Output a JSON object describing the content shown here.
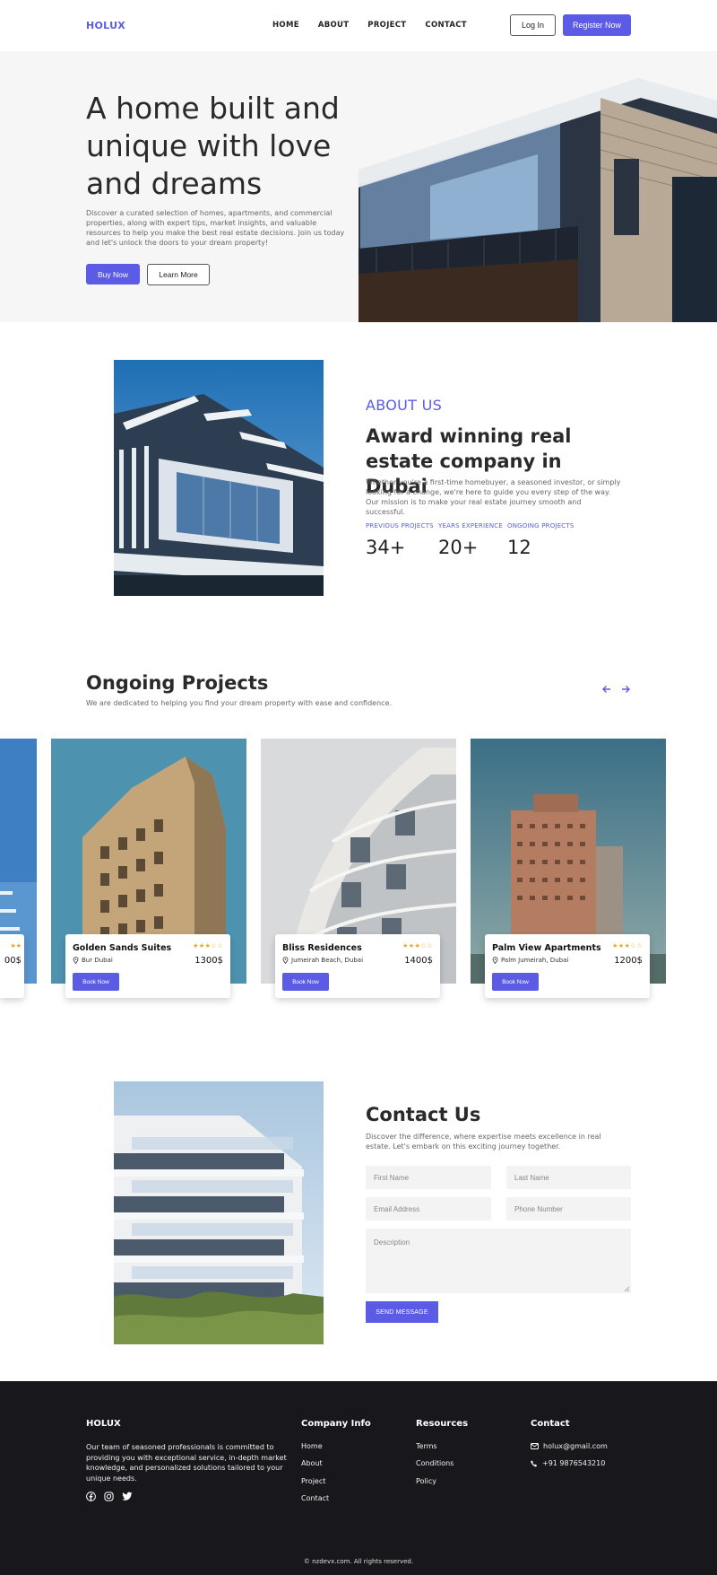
{
  "colors": {
    "accent": "#5b5be6",
    "footer_bg": "#18181c",
    "hero_bg": "#f6f6f6",
    "star": "#e6a817"
  },
  "nav": {
    "logo": "HOLUX",
    "links": [
      "HOME",
      "ABOUT",
      "PROJECT",
      "CONTACT"
    ],
    "login": "Log In",
    "register": "Register Now"
  },
  "hero": {
    "title": "A home built and unique with love and dreams",
    "description": "Discover a curated selection of homes, apartments, and commercial properties, along with expert tips, market insights, and valuable resources to help you make the best real estate decisions. Join us today and let's unlock the doors to your dream property!",
    "buy": "Buy Now",
    "learn": "Learn More"
  },
  "about": {
    "label": "ABOUT US",
    "title": "Award winning real estate company in Dubai",
    "description": "Whether you're a first-time homebuyer, a seasoned investor, or simply looking for a change, we're here to guide you every step of the way. Our mission is to make your real estate journey smooth and successful.",
    "stats": [
      {
        "label": "PREVIOUS PROJECTS",
        "value": "34+"
      },
      {
        "label": "YEARS EXPERIENCE",
        "value": "20+"
      },
      {
        "label": "ONGOING PROJECTS",
        "value": "12"
      }
    ]
  },
  "projects": {
    "title": "Ongoing Projects",
    "subtitle": "We are dedicated to helping you find your dream property with ease and confidence.",
    "partial": {
      "stars": "★★",
      "price": "00$"
    },
    "cards": [
      {
        "name": "Golden Sands Suites",
        "location": "Bur Dubai",
        "price": "1300$",
        "stars": "★★★☆☆",
        "button": "Book Now"
      },
      {
        "name": "Bliss Residences",
        "location": "Jumeirah Beach, Dubai",
        "price": "1400$",
        "stars": "★★★☆☆",
        "button": "Book Now"
      },
      {
        "name": "Palm View Apartments",
        "location": "Palm Jumeirah, Dubai",
        "price": "1200$",
        "stars": "★★★☆☆",
        "button": "Book Now"
      }
    ]
  },
  "contact": {
    "title": "Contact Us",
    "description": "Discover the difference, where expertise meets excellence in real estate. Let's embark on this exciting journey together.",
    "first_name": "First Name",
    "last_name": "Last Name",
    "email": "Email Address",
    "phone": "Phone Number",
    "description_field": "Description",
    "send": "SEND MESSAGE"
  },
  "footer": {
    "brand": "HOLUX",
    "about": "Our team of seasoned professionals is committed to providing you with exceptional service, in-depth market knowledge, and personalized solutions tailored to your unique needs.",
    "company_head": "Company Info",
    "company_links": [
      "Home",
      "About",
      "Project",
      "Contact"
    ],
    "resources_head": "Resources",
    "resources_links": [
      "Terms",
      "Conditions",
      "Policy"
    ],
    "contact_head": "Contact",
    "email": "holux@gmail.com",
    "phone": "+91 9876543210",
    "copyright": "© nzdevx.com. All rights reserved."
  }
}
